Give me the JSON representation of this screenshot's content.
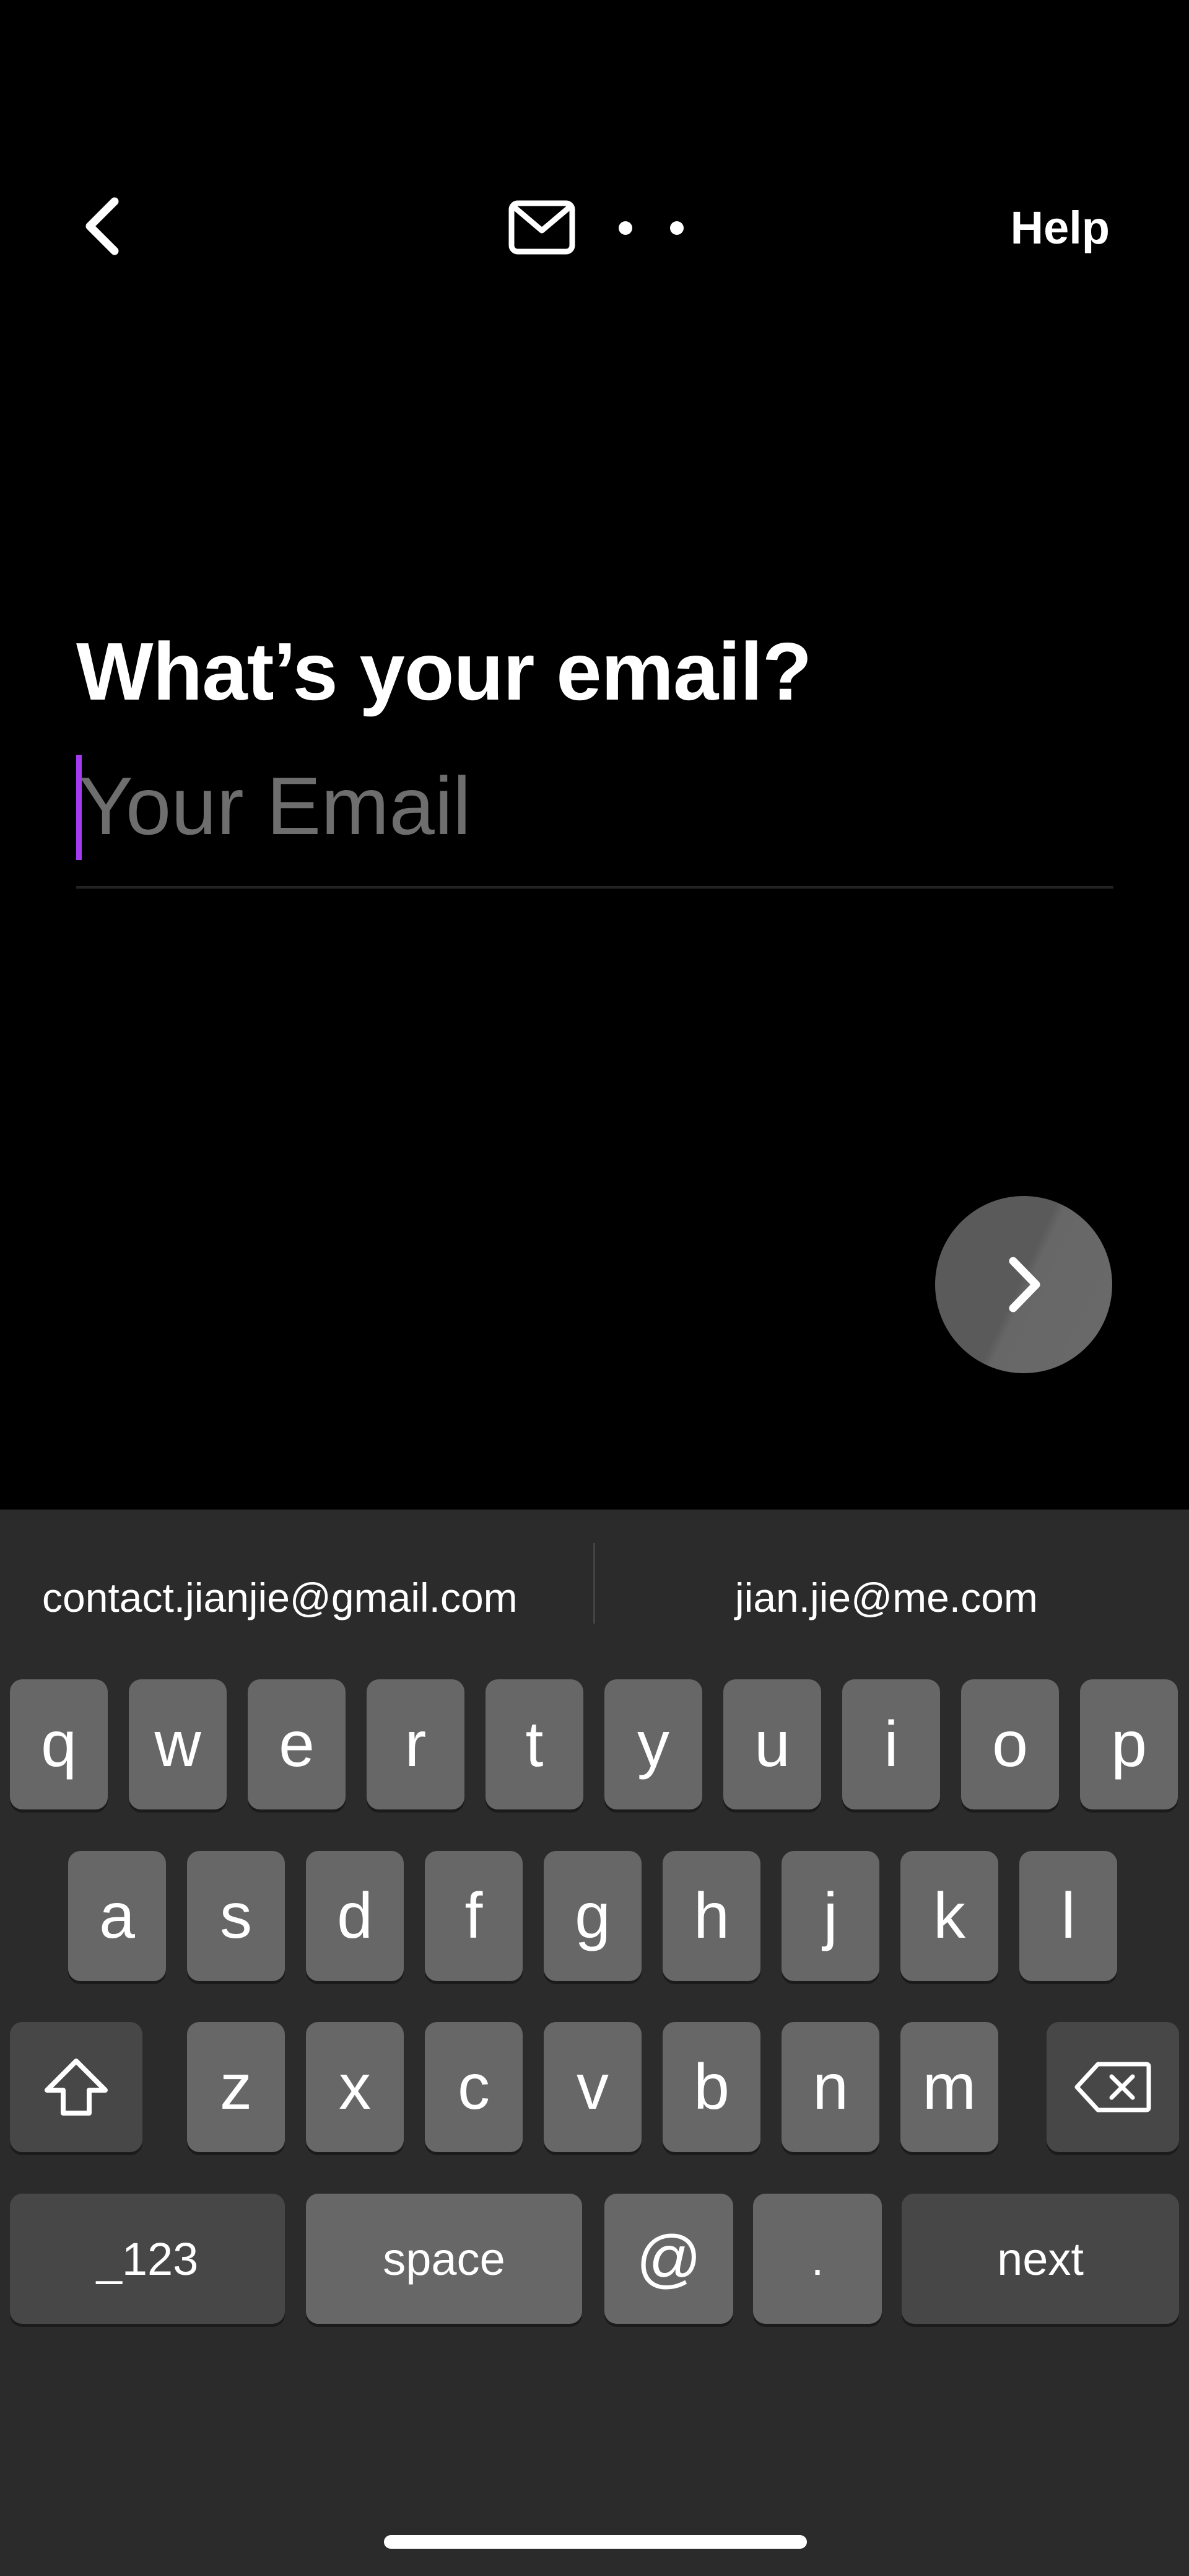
{
  "nav": {
    "help_label": "Help"
  },
  "form": {
    "title": "What’s your email?",
    "email_placeholder": "Your Email",
    "email_value": ""
  },
  "accent_color": "#a43bf0",
  "keyboard": {
    "suggestions": [
      "contact.jianjie@gmail.com",
      "jian.jie@me.com"
    ],
    "row1": [
      "q",
      "w",
      "e",
      "r",
      "t",
      "y",
      "u",
      "i",
      "o",
      "p"
    ],
    "row2": [
      "a",
      "s",
      "d",
      "f",
      "g",
      "h",
      "j",
      "k",
      "l"
    ],
    "row3": [
      "z",
      "x",
      "c",
      "v",
      "b",
      "n",
      "m"
    ],
    "numbers_label": "_123",
    "space_label": "space",
    "at_label": "@",
    "dot_label": ".",
    "next_label": "next"
  }
}
